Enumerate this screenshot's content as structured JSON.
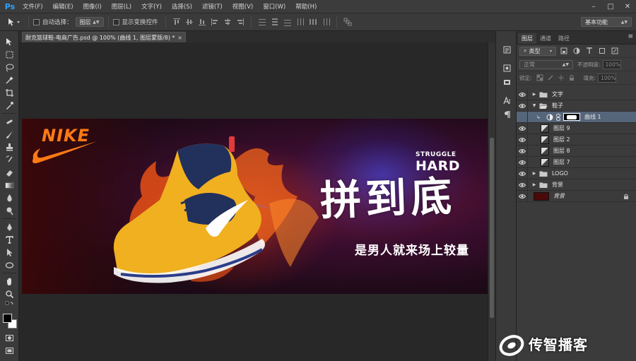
{
  "app": {
    "logo": "Ps",
    "menus": [
      "文件(F)",
      "编辑(E)",
      "图像(I)",
      "图层(L)",
      "文字(Y)",
      "选择(S)",
      "滤镜(T)",
      "视图(V)",
      "窗口(W)",
      "帮助(H)"
    ],
    "window_controls": [
      "–",
      "□",
      "✕"
    ]
  },
  "options": {
    "auto_select_label": "自动选择：",
    "auto_select_value": "图层",
    "show_transform_label": "显示变换控件",
    "workspace": "基本功能"
  },
  "document": {
    "tab_title": "耐克篮球鞋-电商广告.psd @ 100% (曲线 1, 图层蒙版/8) *",
    "tab_close": "×"
  },
  "banner": {
    "brand": "NIKE",
    "slogan_small": "STRUGGLE",
    "slogan_big": "HARD",
    "main_title": "拼到底",
    "subtitle": "是男人就来场上较量"
  },
  "layers_panel": {
    "tabs": [
      "图层",
      "通道",
      "路径"
    ],
    "menu_icon": "≡",
    "filter_kind": "类型",
    "blend_mode": "正常",
    "opacity_label": "不透明度:",
    "opacity_value": "100%",
    "lock_label": "锁定:",
    "fill_label": "填充:",
    "fill_value": "100%",
    "layers": [
      {
        "name": "文字",
        "type": "group",
        "visible": true,
        "expanded": false
      },
      {
        "name": "鞋子",
        "type": "group",
        "visible": true,
        "expanded": true
      },
      {
        "name": "曲线 1",
        "type": "adjustment",
        "visible": false,
        "selected": true
      },
      {
        "name": "图层 9",
        "type": "layer",
        "visible": true
      },
      {
        "name": "图层 2",
        "type": "layer",
        "visible": true
      },
      {
        "name": "图层 8",
        "type": "layer",
        "visible": true
      },
      {
        "name": "图层 7",
        "type": "layer",
        "visible": true
      },
      {
        "name": "LOGO",
        "type": "group",
        "visible": true,
        "expanded": false
      },
      {
        "name": "背景",
        "type": "group",
        "visible": true,
        "expanded": false
      },
      {
        "name": "背景",
        "type": "background",
        "visible": true,
        "locked": true
      }
    ]
  },
  "watermark": {
    "text": "传智播客"
  },
  "colors": {
    "accent_blue": "#2fa3ff",
    "nike_orange": "#ff7a14",
    "selected_layer": "#55657a",
    "panel_bg": "#3b3b3b"
  }
}
